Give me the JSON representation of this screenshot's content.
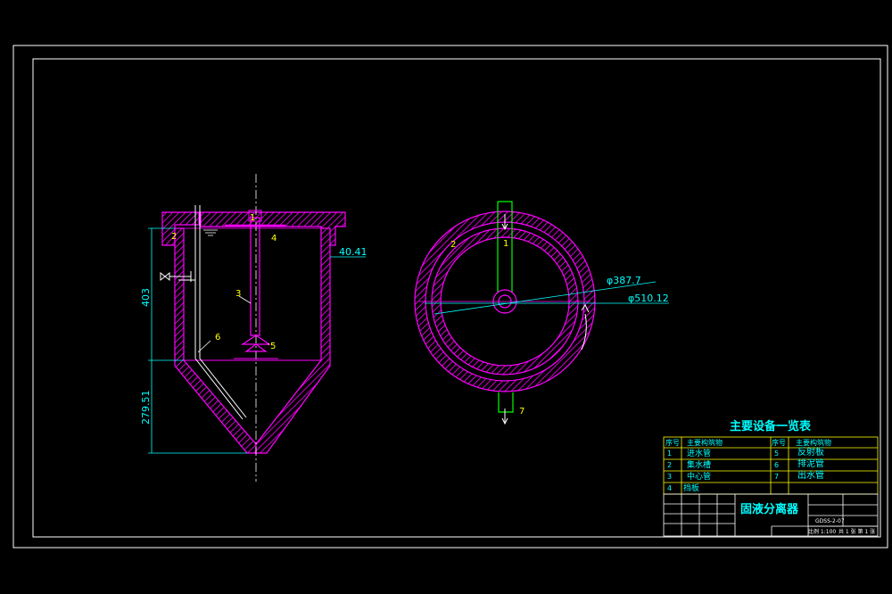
{
  "colors": {
    "background": "#000000",
    "frame": "#ffffff",
    "section": "#ff00ff",
    "dimension": "#00ffff",
    "label": "#ffff00",
    "pipe": "#00ff00",
    "table_border": "#ffff00",
    "table_text": "#00ffff"
  },
  "section_view": {
    "callouts": [
      "1",
      "2",
      "3",
      "4",
      "5",
      "6"
    ],
    "dims": {
      "upper_height": "403",
      "cone_height": "279.51",
      "lip": "40.41"
    }
  },
  "plan_view": {
    "callouts": [
      "1",
      "2",
      "7"
    ],
    "dims": {
      "inner_dia": "φ387.7",
      "outer_dia": "φ510.12"
    }
  },
  "equipment_table": {
    "title": "主要设备一览表",
    "header_no": "序号",
    "header_name": "主要构筑物",
    "rows": [
      {
        "no": "1",
        "name": "进水管",
        "no2": "5",
        "name2": "反射板"
      },
      {
        "no": "2",
        "name": "集水槽",
        "no2": "6",
        "name2": "排泥管"
      },
      {
        "no": "3",
        "name": "中心管",
        "no2": "7",
        "name2": "出水管"
      },
      {
        "no": "4",
        "name": "挡板",
        "no2": "",
        "name2": ""
      }
    ]
  },
  "title_block": {
    "drawing_name": "固液分离器",
    "scale_text": "比例 1:100",
    "sheet_text": "共 1 张 第 1 张",
    "drawing_no": "GDSS-2-07"
  }
}
